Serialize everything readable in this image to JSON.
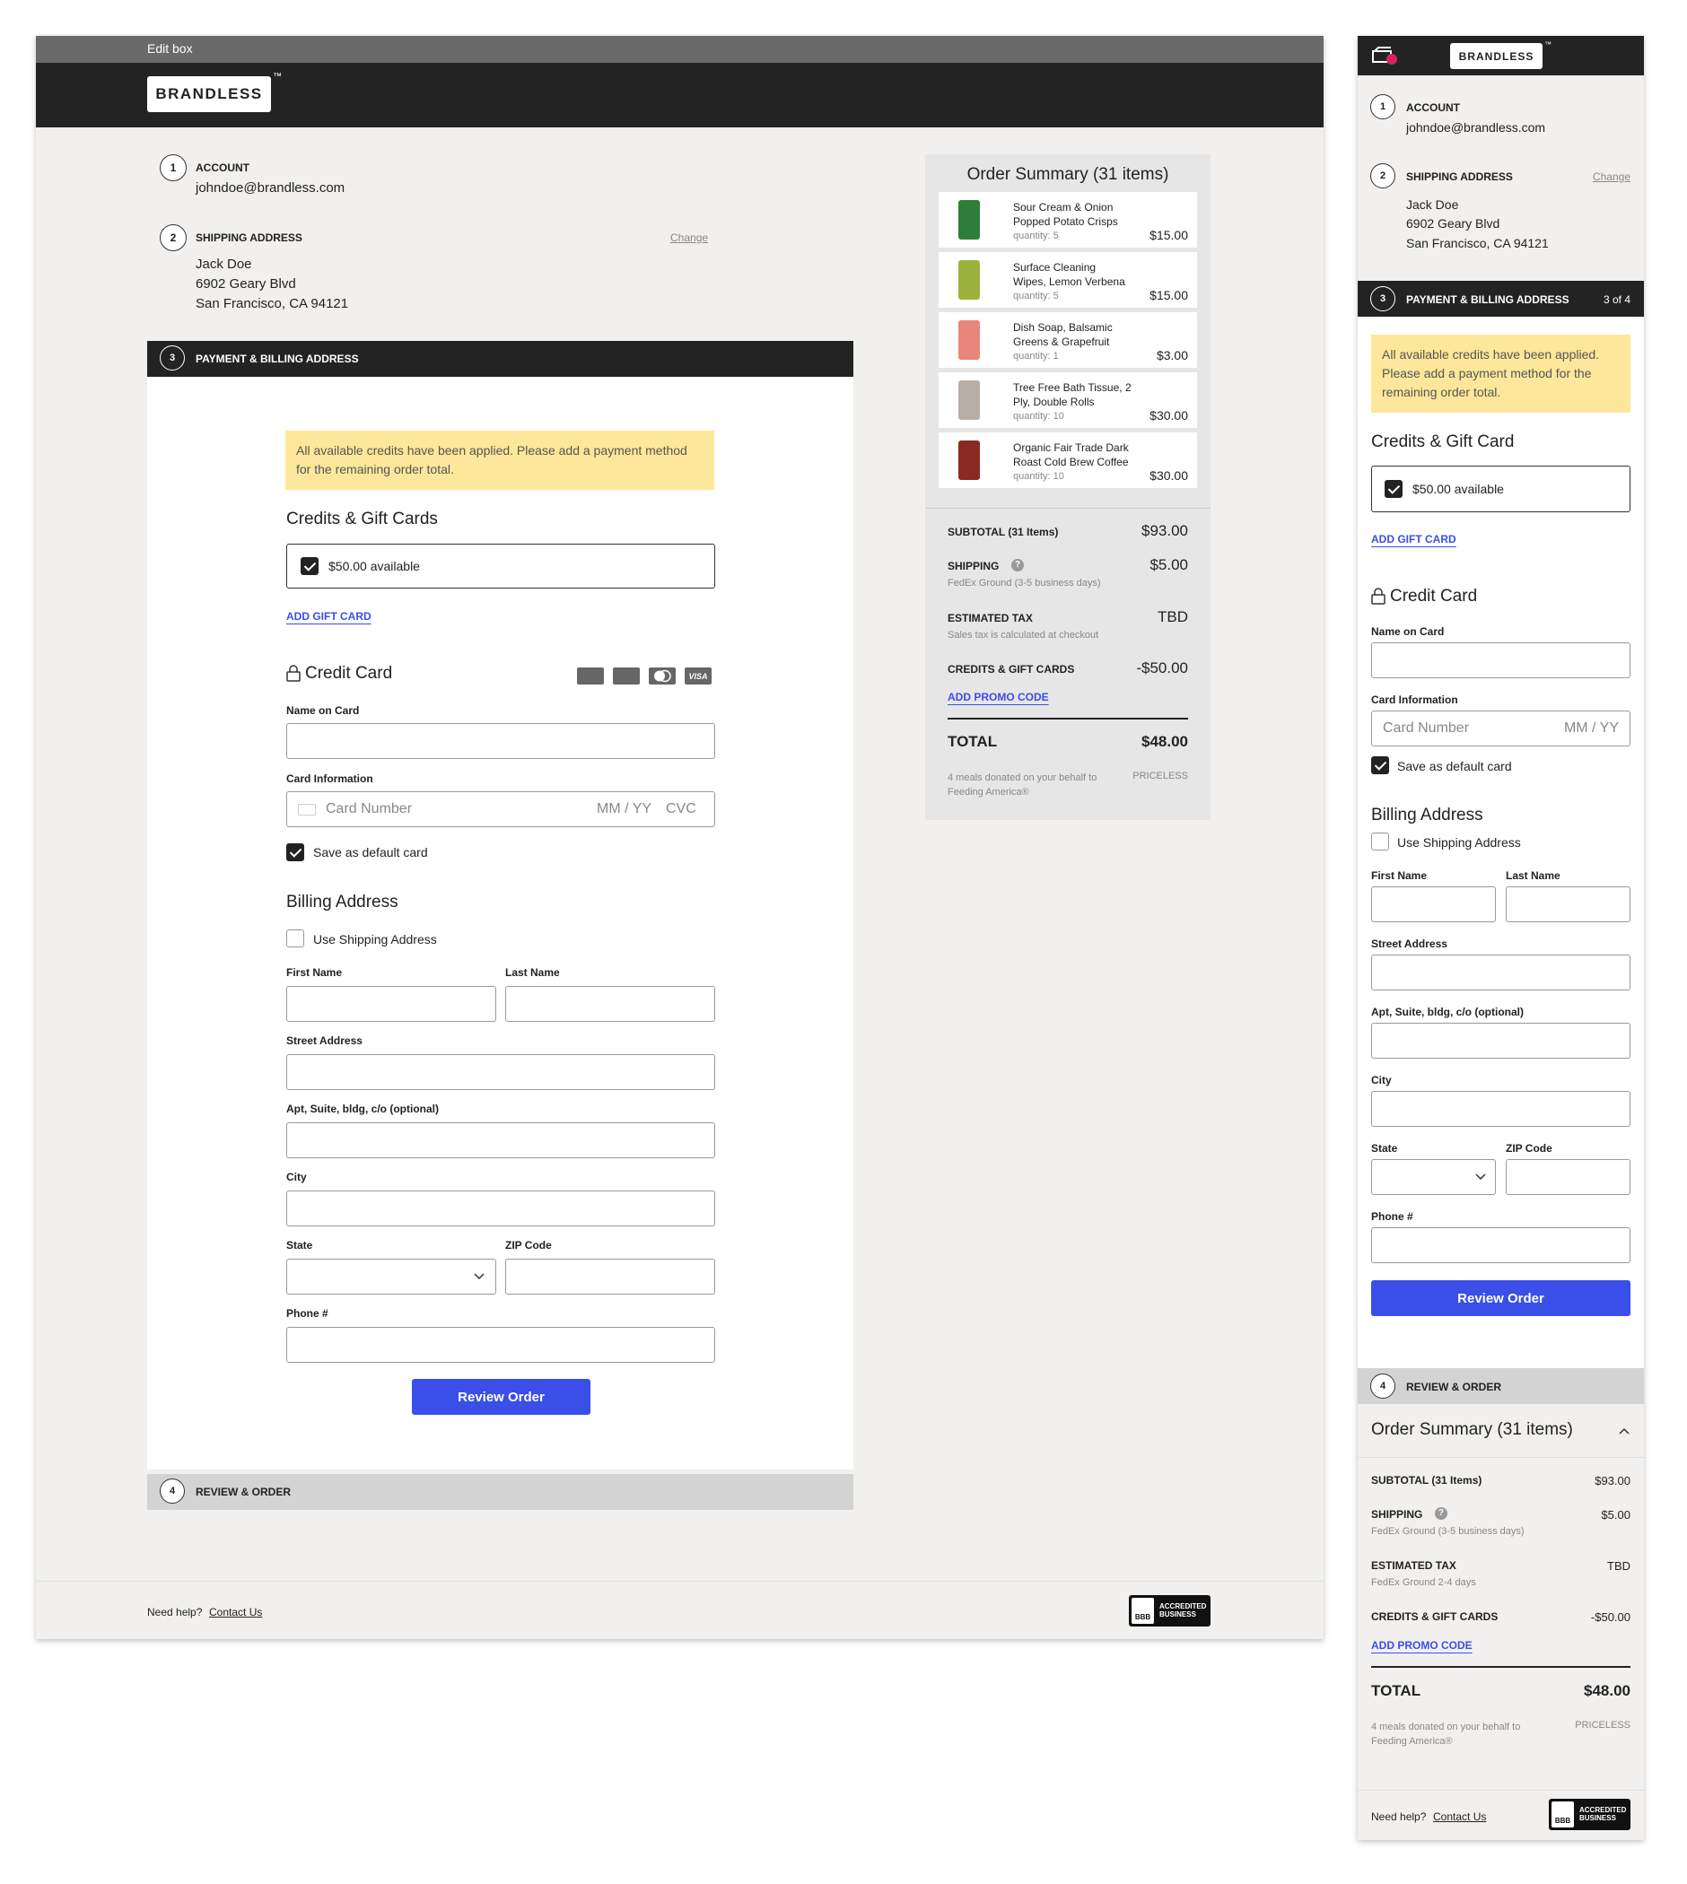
{
  "editbox": {
    "title": "Edit box"
  },
  "brand": {
    "name": "BRANDLESS",
    "tm": "™"
  },
  "steps": {
    "account": {
      "num": "1",
      "label": "ACCOUNT",
      "email": "johndoe@brandless.com"
    },
    "shipping": {
      "num": "2",
      "label": "SHIPPING ADDRESS",
      "change": "Change",
      "name": "Jack Doe",
      "street": "6902 Geary Blvd",
      "city": "San Francisco, CA 94121"
    },
    "payment": {
      "num": "3",
      "label": "PAYMENT & BILLING ADDRESS",
      "progress": "3 of 4"
    },
    "review": {
      "num": "4",
      "label": "REVIEW & ORDER"
    }
  },
  "notice": {
    "text": "All available credits have been applied. Please add a payment method for the remaining order total."
  },
  "credits": {
    "title_desktop": "Credits & Gift Cards",
    "title_mobile": "Credits & Gift Card",
    "available": "$50.00 available",
    "add_gift": "ADD GIFT CARD"
  },
  "card": {
    "title": "Credit Card",
    "name_label": "Name on Card",
    "info_label": "Card Information",
    "number_placeholder": "Card Number",
    "exp_placeholder": "MM / YY",
    "cvc_placeholder": "CVC",
    "save_default": "Save as default card",
    "brands": [
      "DISCOVER",
      "AMEX",
      "MASTERCARD",
      "VISA"
    ]
  },
  "billing": {
    "title": "Billing Address",
    "use_shipping": "Use Shipping Address",
    "first": "First Name",
    "last": "Last Name",
    "street": "Street Address",
    "apt": "Apt, Suite, bldg, c/o (optional)",
    "city": "City",
    "state": "State",
    "zip": "ZIP Code",
    "phone": "Phone #"
  },
  "review_button": "Review Order",
  "summary": {
    "title": "Order Summary (31 items)",
    "items": [
      {
        "name1": "Sour Cream & Onion",
        "name2": "Popped Potato Crisps",
        "qty": "quantity: 5",
        "price": "$15.00",
        "color": "#2f7d3a"
      },
      {
        "name1": "Surface Cleaning",
        "name2": "Wipes, Lemon Verbena",
        "qty": "quantity: 5",
        "price": "$15.00",
        "color": "#9cb23c"
      },
      {
        "name1": "Dish Soap, Balsamic",
        "name2": "Greens & Grapefruit",
        "qty": "quantity: 1",
        "price": "$3.00",
        "color": "#e8867a"
      },
      {
        "name1": "Tree Free Bath Tissue, 2",
        "name2": "Ply, Double Rolls",
        "qty": "quantity: 10",
        "price": "$30.00",
        "color": "#b8aea5"
      },
      {
        "name1": "Organic Fair Trade Dark",
        "name2": "Roast Cold Brew Coffee",
        "qty": "quantity: 10",
        "price": "$30.00",
        "color": "#8b2a22"
      }
    ],
    "subtotal_label": "SUBTOTAL (31 Items)",
    "subtotal": "$93.00",
    "shipping_label": "SHIPPING",
    "shipping": "$5.00",
    "shipping_note": "FedEx Ground (3-5 business days)",
    "tax_label": "ESTIMATED TAX",
    "tax": "TBD",
    "tax_note": "Sales tax is calculated at checkout",
    "tax_note_mobile": "FedEx Ground 2-4 days",
    "credits_label": "CREDITS & GIFT CARDS",
    "credits": "-$50.00",
    "promo": "ADD PROMO CODE",
    "total_label": "TOTAL",
    "total": "$48.00",
    "donation": "4 meals donated on your behalf to Feeding America®",
    "priceless": "PRICELESS"
  },
  "footer": {
    "help": "Need help?",
    "contact": "Contact Us",
    "bbb": "ACCREDITED BUSINESS",
    "bbb_short": "BBB"
  },
  "colors": {
    "accent": "#3a4ee8",
    "dark": "#232323",
    "notice": "#fde79a",
    "panel": "#f1f0ee",
    "summary": "#e6e6e6"
  }
}
